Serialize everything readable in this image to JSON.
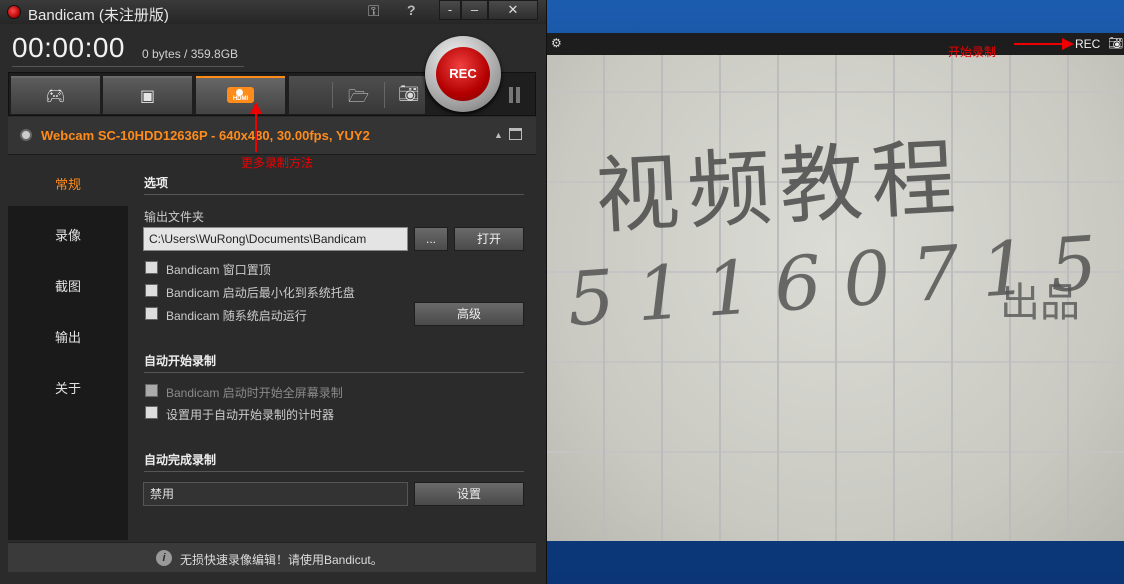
{
  "bandicam": {
    "title": "Bandicam (未注册版)",
    "timer": "00:00:00",
    "size_info": "0 bytes / 359.8GB",
    "rec_label": "REC",
    "device_info": "Webcam SC-10HDD12636P - 640x480, 30.00fps, YUY2",
    "hdmi_label": "HDMI",
    "sidebar": [
      "常规",
      "录像",
      "截图",
      "输出",
      "关于"
    ],
    "options": {
      "section_title": "选项",
      "output_folder_label": "输出文件夹",
      "output_folder_value": "C:\\Users\\WuRong\\Documents\\Bandicam",
      "browse_label": "...",
      "open_label": "打开",
      "checkbox_topmost": "Bandicam 窗口置顶",
      "checkbox_minimize": "Bandicam 启动后最小化到系统托盘",
      "checkbox_autostart": "Bandicam 随系统启动运行",
      "advanced_label": "高级"
    },
    "auto_start": {
      "section_title": "自动开始录制",
      "checkbox_fullscreen": "Bandicam 启动时开始全屏幕录制",
      "checkbox_timer": "设置用于自动开始录制的计时器"
    },
    "auto_complete": {
      "section_title": "自动完成录制",
      "value": "禁用",
      "settings_label": "设置"
    },
    "status": "无损快速录像编辑！请使用Bandicut。"
  },
  "annotations": {
    "more_methods": "更多录制方法",
    "start_recording": "开始录制"
  },
  "preview": {
    "rec_label": "REC",
    "handwriting_line1": "视频教程",
    "handwriting_line2": "51160715",
    "handwriting_line3": "出品"
  },
  "colors": {
    "accent": "#ff8c1a",
    "rec_red": "#c00000",
    "annotation_red": "#e00000"
  }
}
